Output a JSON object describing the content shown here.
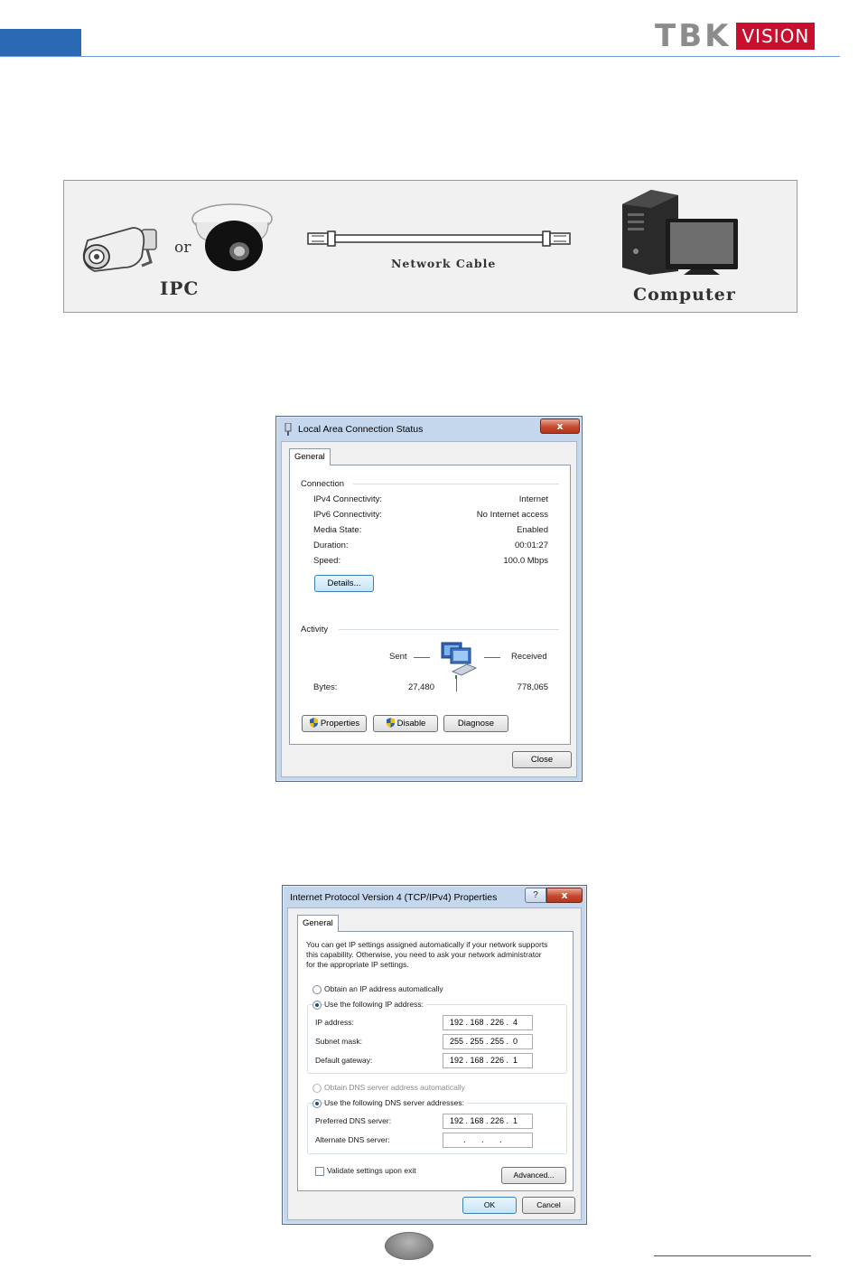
{
  "header": {
    "logo_main": "TBK",
    "logo_badge": "VISION"
  },
  "diagram": {
    "or_label": "or",
    "ipc_label": "IPC",
    "cable_label": "Network Cable",
    "computer_label": "Computer"
  },
  "status_dialog": {
    "title": "Local Area Connection Status",
    "tab": "General",
    "connection_heading": "Connection",
    "rows": [
      {
        "label": "IPv4 Connectivity:",
        "value": "Internet"
      },
      {
        "label": "IPv6 Connectivity:",
        "value": "No Internet access"
      },
      {
        "label": "Media State:",
        "value": "Enabled"
      },
      {
        "label": "Duration:",
        "value": "00:01:27"
      },
      {
        "label": "Speed:",
        "value": "100.0 Mbps"
      }
    ],
    "details_button": "Details...",
    "activity_heading": "Activity",
    "sent_label": "Sent",
    "received_label": "Received",
    "bytes_label": "Bytes:",
    "bytes_sent": "27,480",
    "bytes_received": "778,065",
    "properties_button": "Properties",
    "disable_button": "Disable",
    "diagnose_button": "Diagnose",
    "close_button": "Close",
    "close_glyph": "x"
  },
  "ipv4_dialog": {
    "title": "Internet Protocol Version 4 (TCP/IPv4) Properties",
    "help_glyph": "?",
    "close_glyph": "x",
    "tab": "General",
    "intro_line1": "You can get IP settings assigned automatically if your network supports",
    "intro_line2": "this capability. Otherwise, you need to ask your network administrator",
    "intro_line3": "for the appropriate IP settings.",
    "obtain_ip_auto": "Obtain an IP address automatically",
    "use_following_ip": "Use the following IP address:",
    "ip_address_label": "IP address:",
    "ip_address_value": "192 . 168 . 226 .  4",
    "subnet_mask_label": "Subnet mask:",
    "subnet_mask_value": "255 . 255 . 255 .  0",
    "gateway_label": "Default gateway:",
    "gateway_value": "192 . 168 . 226 .  1",
    "obtain_dns_auto": "Obtain DNS server address automatically",
    "use_following_dns": "Use the following DNS server addresses:",
    "preferred_dns_label": "Preferred DNS server:",
    "preferred_dns_value": "192 . 168 . 226 .  1",
    "alternate_dns_label": "Alternate DNS server:",
    "alternate_dns_value": "      .       .       .",
    "validate_label": "Validate settings upon exit",
    "advanced_button": "Advanced...",
    "ok_button": "OK",
    "cancel_button": "Cancel"
  },
  "colors": {
    "header_blue": "#2a6ab5",
    "logo_red": "#c8102e",
    "logo_grey": "#8c8c8c"
  }
}
